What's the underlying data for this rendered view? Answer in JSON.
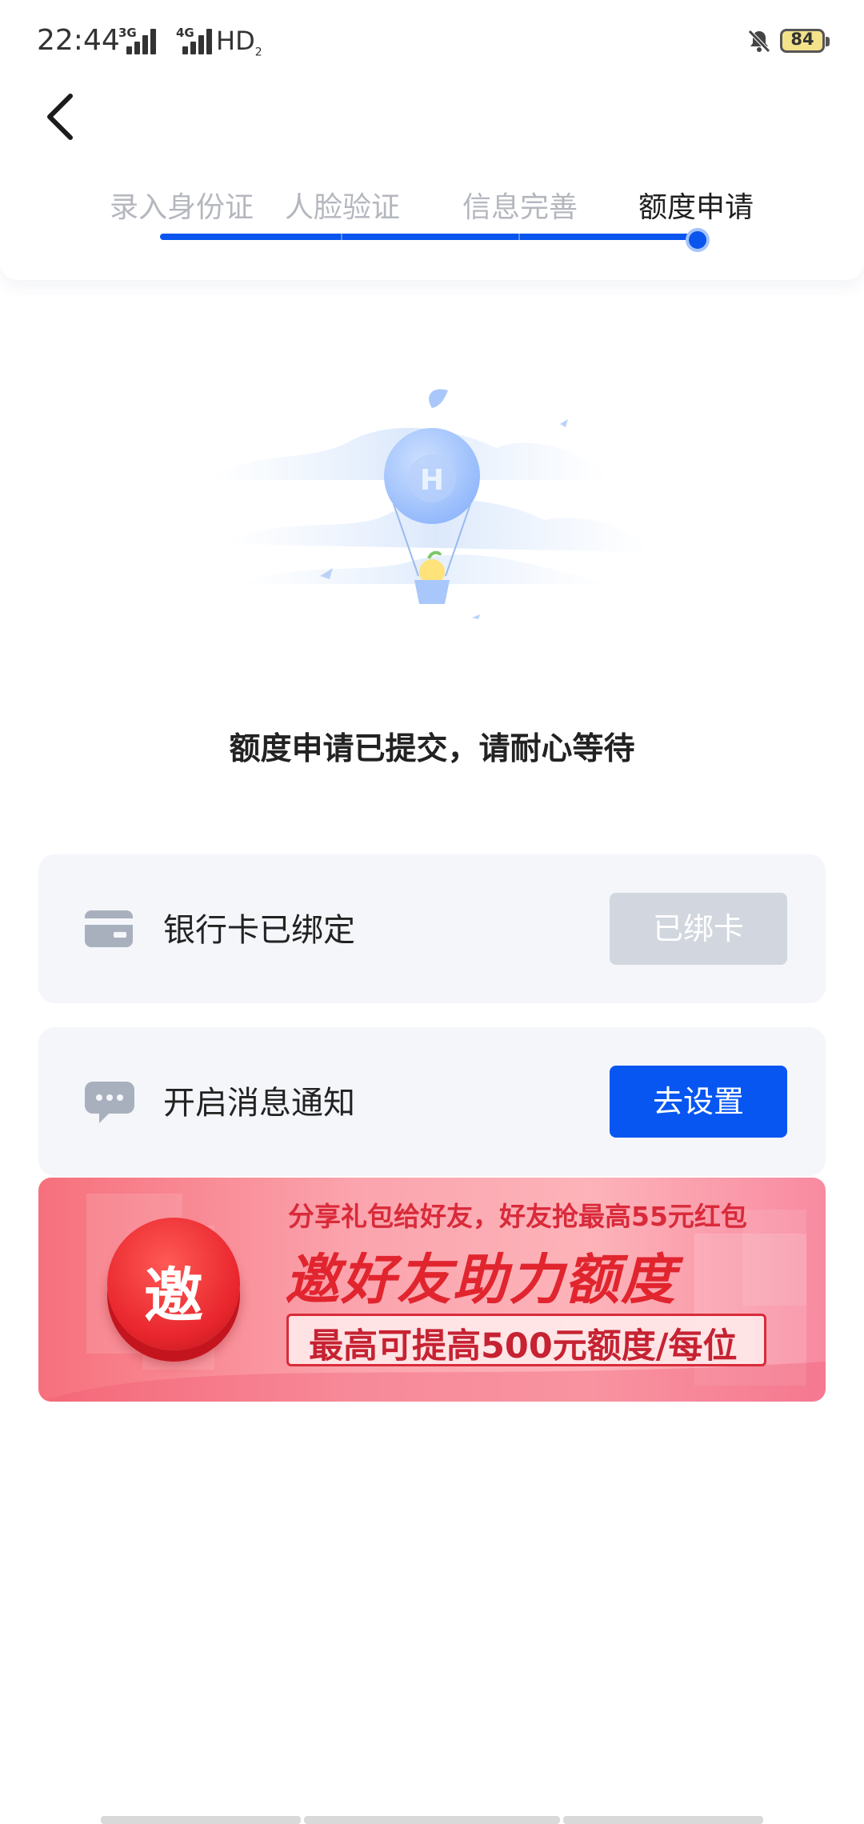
{
  "status_bar": {
    "time": "22:44",
    "network_1": "3G",
    "network_2": "4G",
    "hd": "HD",
    "hd_sub": "2",
    "battery": "84"
  },
  "steps": [
    {
      "label": "录入身份证",
      "active": false
    },
    {
      "label": "人脸验证",
      "active": false
    },
    {
      "label": "信息完善",
      "active": false
    },
    {
      "label": "额度申请",
      "active": true
    }
  ],
  "message": "额度申请已提交，请耐心等待",
  "cards": {
    "bank": {
      "label": "银行卡已绑定",
      "button": "已绑卡",
      "icon": "bank-card-icon"
    },
    "notify": {
      "label": "开启消息通知",
      "button": "去设置",
      "icon": "chat-bubble-icon"
    }
  },
  "banner": {
    "badge": "邀",
    "line1": "分享礼包给好友，好友抢最高55元红包",
    "line2": "邀好友助力额度",
    "line3": "最高可提高500元额度/每位"
  },
  "colors": {
    "primary": "#0756f2",
    "disabled": "#d2d6de",
    "banner_red": "#e1252f"
  }
}
